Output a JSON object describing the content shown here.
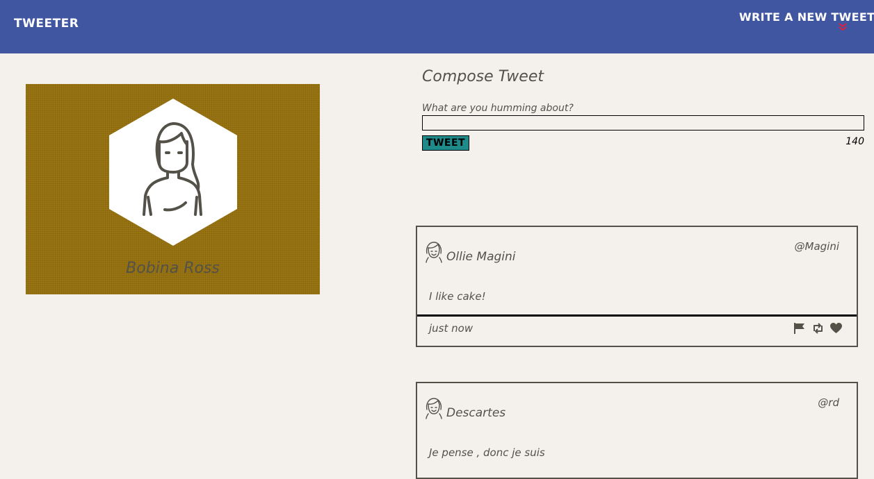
{
  "nav": {
    "brand": "TWEETER",
    "write_tweet": "WRITE A NEW TWEET",
    "chevron_icon": "double-chevron-down-icon",
    "chevron_color": "#e0203c",
    "background": "#4056a1"
  },
  "profile": {
    "name": "Bobina Ross",
    "avatar_icon": "female-avatar-icon",
    "card_color": "#9a7512"
  },
  "compose": {
    "title": "Compose Tweet",
    "label": "What are you humming about?",
    "input_value": "",
    "button_label": "TWEET",
    "button_color": "#1e8a8a",
    "counter": "140"
  },
  "tweets": [
    {
      "name": "Ollie Magini",
      "handle": "@Magini",
      "text": "I like cake!",
      "time": "just now",
      "avatar_icon": "female-avatar-icon",
      "actions": [
        "flag-icon",
        "retweet-icon",
        "heart-icon"
      ]
    },
    {
      "name": "Descartes",
      "handle": "@rd",
      "text": "Je pense , donc je suis",
      "avatar_icon": "female-avatar-icon"
    }
  ]
}
